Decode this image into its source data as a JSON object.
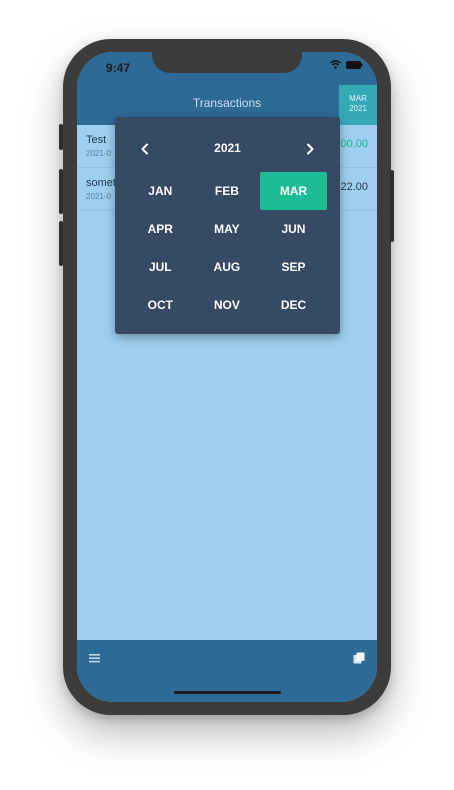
{
  "status_bar": {
    "time": "9:47"
  },
  "header": {
    "title": "Transactions",
    "month_chip": {
      "month": "MAR",
      "year": "2021"
    }
  },
  "transactions": [
    {
      "name": "Test",
      "date": "2021-0",
      "amount": "00.00",
      "positive": true
    },
    {
      "name": "somet",
      "date": "2021-0",
      "amount": "22.00",
      "positive": false
    }
  ],
  "month_picker": {
    "year": "2021",
    "months": [
      "JAN",
      "FEB",
      "MAR",
      "APR",
      "MAY",
      "JUN",
      "JUL",
      "AUG",
      "SEP",
      "OCT",
      "NOV",
      "DEC"
    ],
    "selected": "MAR"
  },
  "bottom_bar": {
    "left_icon": "menu-icon",
    "right_icon": "copy-icon"
  },
  "colors": {
    "header": "#2e6a96",
    "screen_background": "#9ecfee",
    "picker_background": "#364a63",
    "selected_month": "#1cbc96",
    "chip": "#35a9b8"
  }
}
